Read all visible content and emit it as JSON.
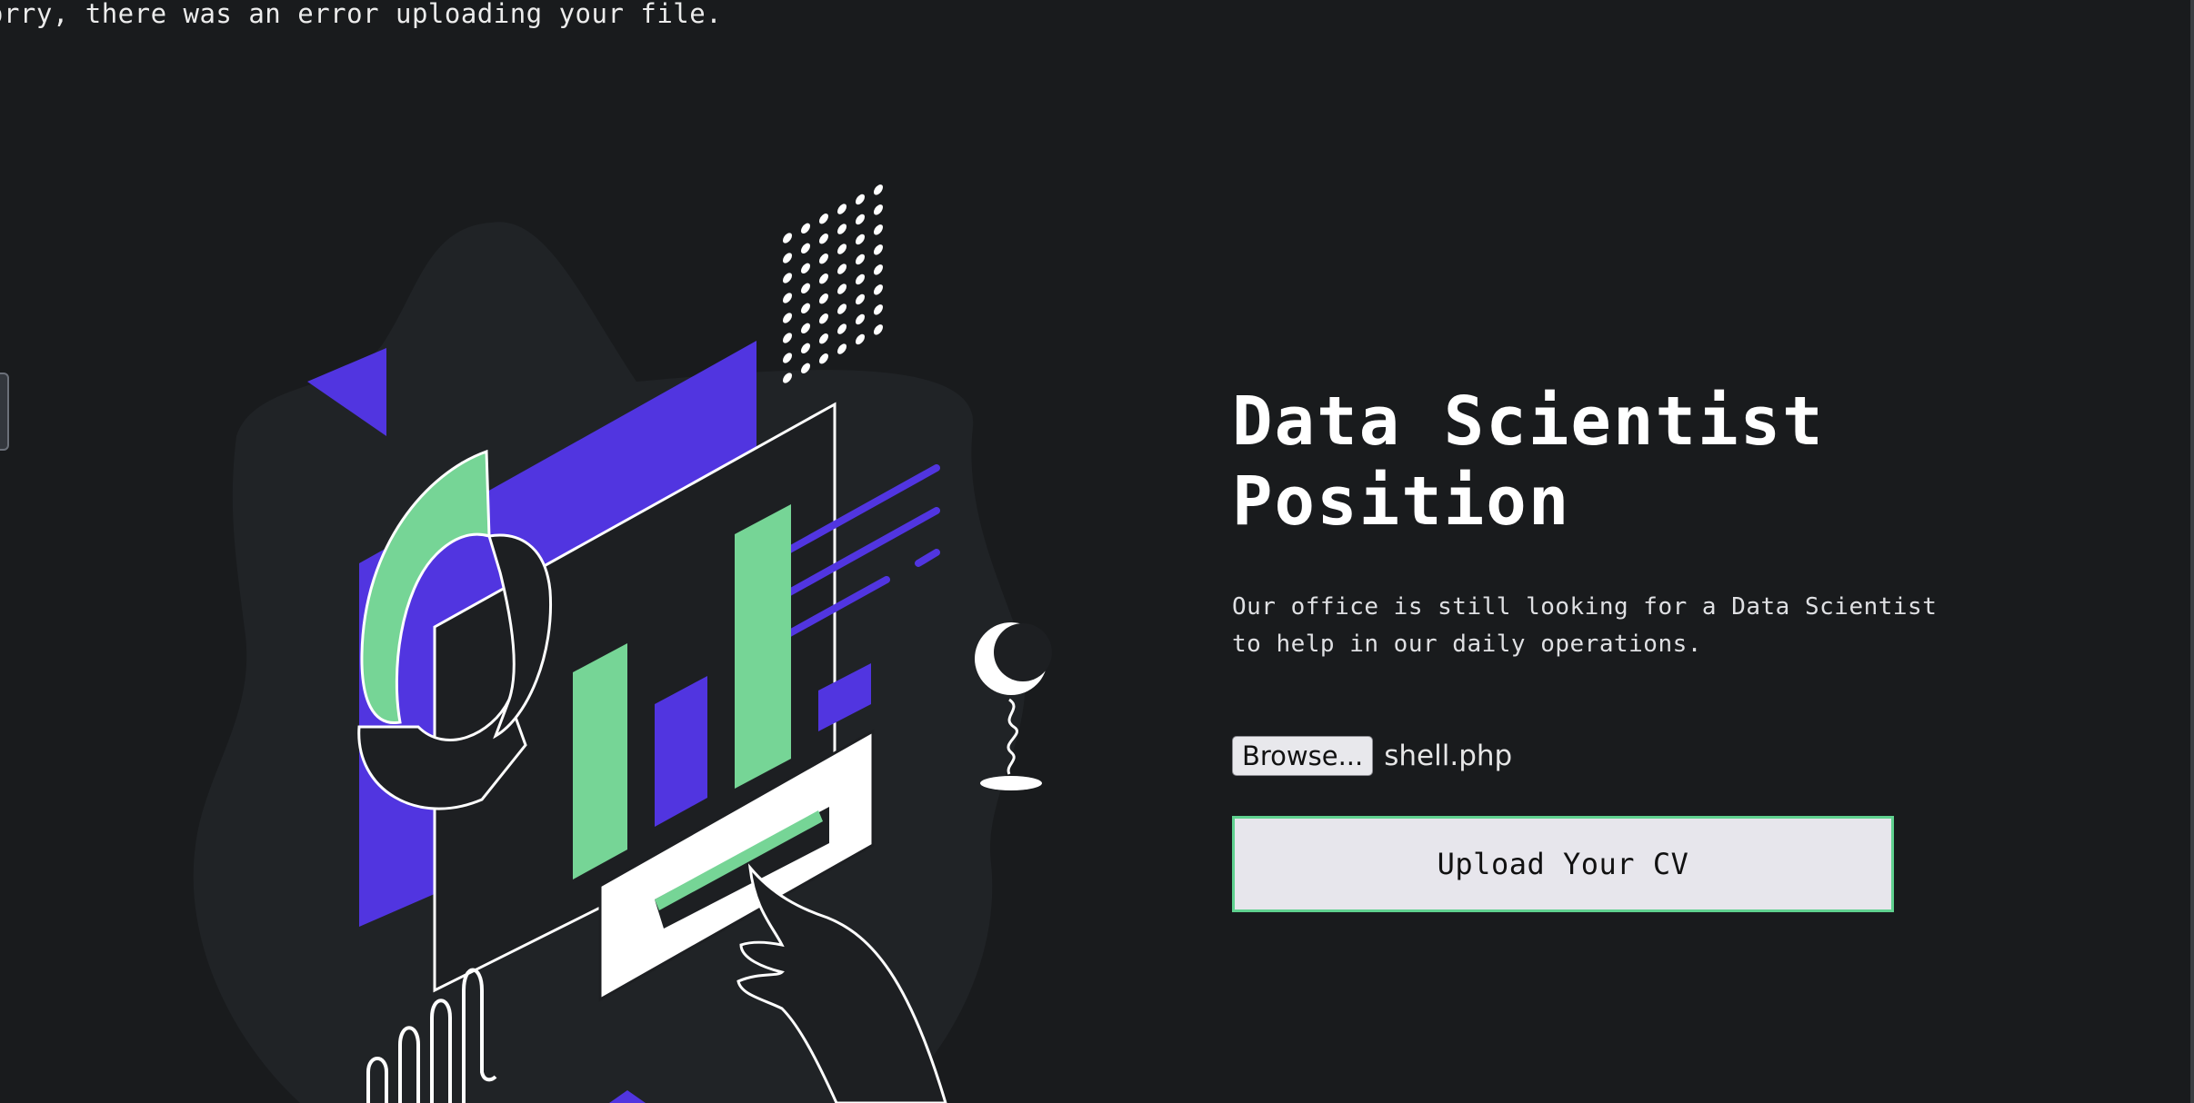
{
  "message": {
    "error": "orry, there was an error uploading your file."
  },
  "job": {
    "title": "Data Scientist Position",
    "description": "Our office is still looking for a Data Scientist to help in our daily operations."
  },
  "upload": {
    "browse_label": "Browse...",
    "selected_file": "shell.php",
    "submit_label": "Upload Your CV"
  },
  "colors": {
    "background": "#191b1d",
    "accent_green": "#76d596",
    "accent_purple": "#5135e0",
    "blob": "#222528"
  },
  "icons": {
    "illustration": "data-analytics-illustration"
  }
}
